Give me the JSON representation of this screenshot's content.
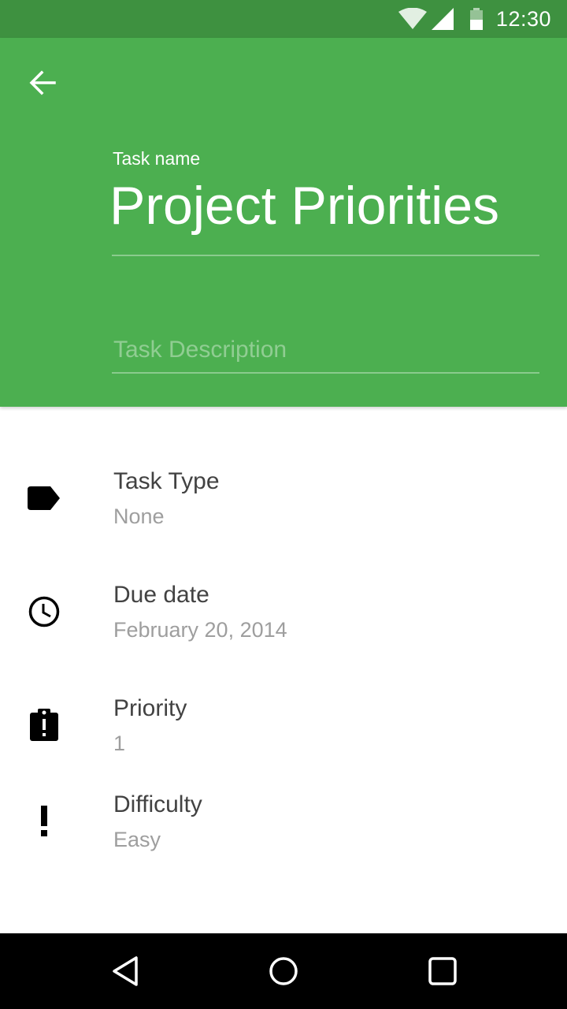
{
  "status_bar": {
    "time": "12:30",
    "icons": [
      "wifi-icon",
      "cellular-signal-icon",
      "battery-icon"
    ]
  },
  "header": {
    "back_icon": "arrow-back-icon",
    "task_name_label": "Task name",
    "task_name_value": "Project Priorities",
    "description_placeholder": "Task Description",
    "description_value": "",
    "color": "#4caf50"
  },
  "fields": [
    {
      "icon": "label-tag-icon",
      "label": "Task Type",
      "value": "None"
    },
    {
      "icon": "clock-icon",
      "label": "Due date",
      "value": "February 20, 2014"
    },
    {
      "icon": "assignment-late-icon",
      "label": "Priority",
      "value": "1"
    },
    {
      "icon": "exclamation-icon",
      "label": "Difficulty",
      "value": "Easy"
    }
  ],
  "nav_bar": {
    "buttons": [
      "back-triangle-icon",
      "home-circle-icon",
      "recents-square-icon"
    ]
  }
}
